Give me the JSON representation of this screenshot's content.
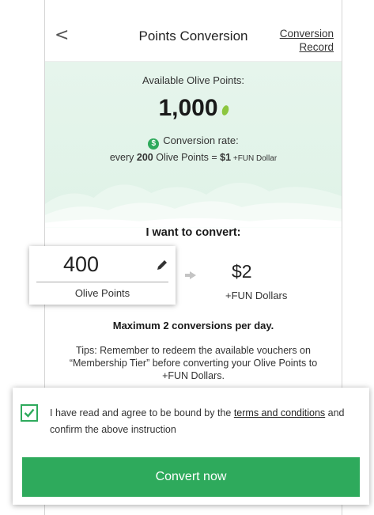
{
  "header": {
    "back_glyph": "<",
    "title": "Points Conversion",
    "record_line1": "Conversion",
    "record_line2": "Record"
  },
  "balance": {
    "label": "Available Olive Points:",
    "points": "1,000",
    "points_icon": "olive-icon"
  },
  "rate": {
    "badge": "$",
    "label": "Conversion rate:",
    "prefix": "every ",
    "points": "200",
    "middle": " Olive Points = ",
    "dollars": "$1",
    "suffix": " +FUN Dollar"
  },
  "convert": {
    "heading": "I want to convert:",
    "input_value": "400",
    "input_unit": "Olive Points",
    "output_value": "$2",
    "output_unit": "+FUN Dollars",
    "max_note": "Maximum 2 conversions per day.",
    "tips": "Tips: Remember to redeem the available vouchers on “Membership Tier” before converting your Olive Points to +FUN Dollars."
  },
  "agreement": {
    "checked": true,
    "text_before": "I have read and agree to be bound by the ",
    "link": "terms and conditions",
    "text_after": " and confirm the above instruction",
    "button": "Convert now"
  },
  "colors": {
    "brand_green": "#2eaa5c",
    "background_mint": "#e6f5ec"
  }
}
